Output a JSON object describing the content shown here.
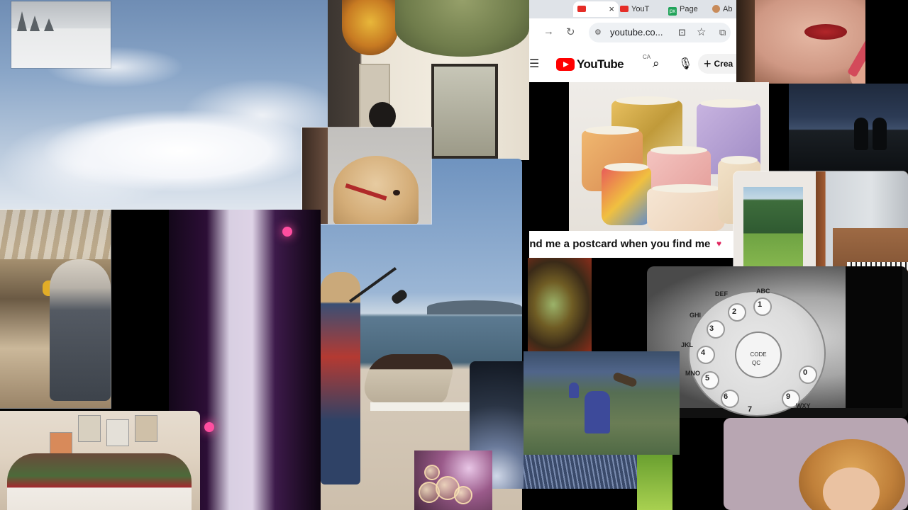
{
  "browser": {
    "tabs": [
      {
        "label": "",
        "icon": "youtube-favicon"
      },
      {
        "label": "YouT",
        "icon": "youtube-favicon"
      },
      {
        "label": "Page",
        "icon": "px-favicon"
      },
      {
        "label": "Ab",
        "icon": "avatar-favicon"
      }
    ],
    "active_tab_close": "×",
    "nav_forward": "→",
    "nav_reload": "↻",
    "url": "youtube.co...",
    "youtube": {
      "logo_text": "YouTube",
      "region": "CA",
      "create_label": "Crea"
    }
  },
  "video_caption": "end me a postcard when you find me",
  "dial": {
    "center_text": "CODE",
    "center_sub": "QC",
    "labels": [
      "ABC",
      "DEF",
      "GHI",
      "JKL",
      "MNO",
      "WXY",
      "1",
      "2",
      "3",
      "4",
      "5",
      "6",
      "9",
      "0",
      "7"
    ]
  },
  "colors": {
    "youtube_red": "#ff0000",
    "heart": "#e0245e"
  }
}
